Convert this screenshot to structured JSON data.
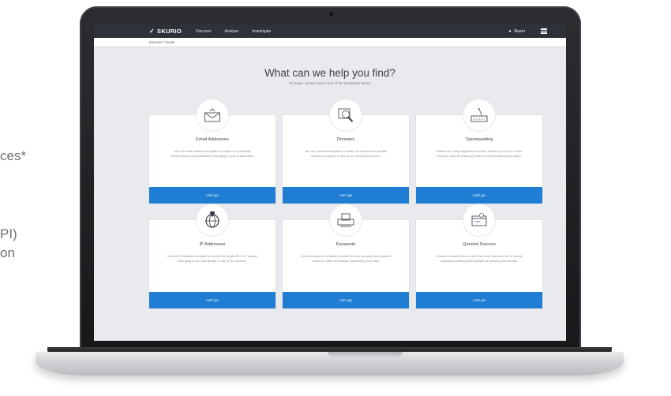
{
  "side_text": {
    "line1": "ces*",
    "line2": "PI)",
    "line3": "on"
  },
  "app": {
    "brand": "SKURIO",
    "nav": [
      "Discover",
      "Analyse",
      "Investigate"
    ],
    "user_label": "Skurio",
    "breadcrumb": "Discover / Create"
  },
  "hero": {
    "title": "What can we help you find?",
    "subtitle": "To begin, please select one of the templates below"
  },
  "cards": [
    {
      "title": "Email Addresses",
      "description": "Use the email address template to monitor for potentially compromised email addresses belonging to your organisation.",
      "button": "Let's go",
      "icon": "envelope-icon"
    },
    {
      "title": "Domains",
      "description": "Use the domains template to monitor for mentions of domain names that appear in any of our monitored sources.",
      "button": "Let's go",
      "icon": "magnifier-icon"
    },
    {
      "title": "Typosquatting",
      "description": "Monitor for newly registered domains similar to your own which could be used for phishing, fraud or impersonating your brand.",
      "button": "Let's go",
      "icon": "keyboard-icon"
    },
    {
      "title": "IP Addresses",
      "description": "Use the IP Address template to monitor for single IPs or IP ranges belonging to you that appear in any of our sources.",
      "button": "Let's go",
      "icon": "globe-pin-icon"
    },
    {
      "title": "Keywords",
      "description": "Use the keyword template to watch for your company and product names or other text strings that identify your data.",
      "button": "Let's go",
      "icon": "printer-icon"
    },
    {
      "title": "Queried Sources",
      "description": "Forward content from our dark and deep web sources to enable ongoing monitoring and analysis of various open threats.",
      "button": "Let's go",
      "icon": "browser-icon"
    }
  ],
  "colors": {
    "topbar": "#2d3138",
    "accent": "#1f7ed3",
    "page_bg": "#e8eaed"
  }
}
